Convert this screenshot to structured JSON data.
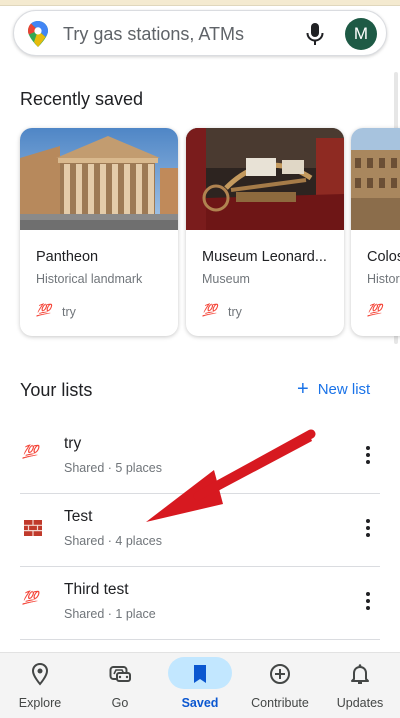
{
  "search": {
    "placeholder": "Try gas stations, ATMs",
    "avatar_letter": "M"
  },
  "recently_saved": {
    "title": "Recently saved",
    "cards": [
      {
        "title": "Pantheon",
        "subtitle": "Historical landmark",
        "list_emoji": "💯",
        "list_name": "try"
      },
      {
        "title": "Museum Leonard...",
        "subtitle": "Museum",
        "list_emoji": "💯",
        "list_name": "try"
      },
      {
        "title": "Colos",
        "subtitle": "Histor",
        "list_emoji": "💯",
        "list_name": ""
      }
    ]
  },
  "your_lists": {
    "title": "Your lists",
    "new_list_label": "New list",
    "items": [
      {
        "icon": "hundred-points-icon",
        "title": "try",
        "meta": "Shared · 5 places"
      },
      {
        "icon": "brick-icon",
        "title": "Test",
        "meta": "Shared · 4 places"
      },
      {
        "icon": "hundred-points-icon",
        "title": "Third test",
        "meta": "Shared · 1 place"
      }
    ]
  },
  "bottom_nav": {
    "items": [
      {
        "icon": "location-pin-icon",
        "label": "Explore"
      },
      {
        "icon": "car-icon",
        "label": "Go"
      },
      {
        "icon": "bookmark-icon",
        "label": "Saved",
        "active": true
      },
      {
        "icon": "add-circle-icon",
        "label": "Contribute"
      },
      {
        "icon": "bell-icon",
        "label": "Updates"
      }
    ]
  },
  "colors": {
    "accent": "#1a73e8",
    "active_pill": "#c2e7ff",
    "annotation_arrow": "#d71920"
  }
}
